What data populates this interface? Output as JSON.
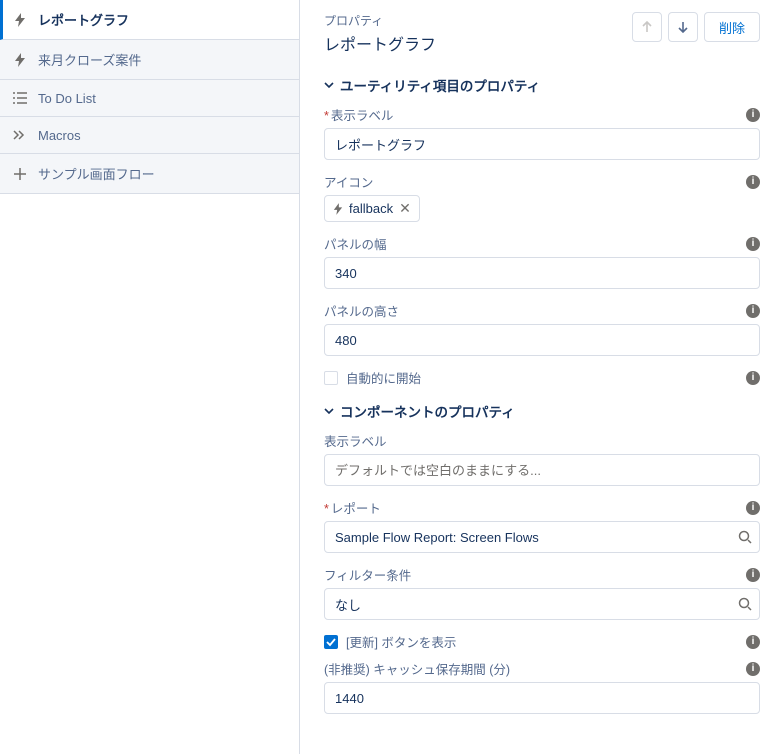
{
  "sidebar": {
    "items": [
      {
        "label": "レポートグラフ",
        "icon": "bolt"
      },
      {
        "label": "来月クローズ案件",
        "icon": "bolt"
      },
      {
        "label": "To Do List",
        "icon": "checklist"
      },
      {
        "label": "Macros",
        "icon": "chevrons"
      },
      {
        "label": "サンプル画面フロー",
        "icon": "plus"
      }
    ]
  },
  "header": {
    "caption": "プロパティ",
    "title": "レポートグラフ",
    "delete_label": "削除"
  },
  "sections": {
    "utility": "ユーティリティ項目のプロパティ",
    "component": "コンポーネントのプロパティ"
  },
  "utility": {
    "display_label": {
      "label": "表示ラベル",
      "value": "レポートグラフ"
    },
    "icon": {
      "label": "アイコン",
      "value": "fallback"
    },
    "panel_width": {
      "label": "パネルの幅",
      "value": "340"
    },
    "panel_height": {
      "label": "パネルの高さ",
      "value": "480"
    },
    "autostart": {
      "label": "自動的に開始",
      "checked": false
    }
  },
  "component": {
    "display_label": {
      "label": "表示ラベル",
      "placeholder": "デフォルトでは空白のままにする..."
    },
    "report": {
      "label": "レポート",
      "value": "Sample Flow Report: Screen Flows"
    },
    "filter": {
      "label": "フィルター条件",
      "value": "なし"
    },
    "show_refresh": {
      "label": "[更新] ボタンを表示",
      "checked": true
    },
    "cache_duration": {
      "label": "(非推奨) キャッシュ保存期間 (分)",
      "value": "1440"
    }
  }
}
